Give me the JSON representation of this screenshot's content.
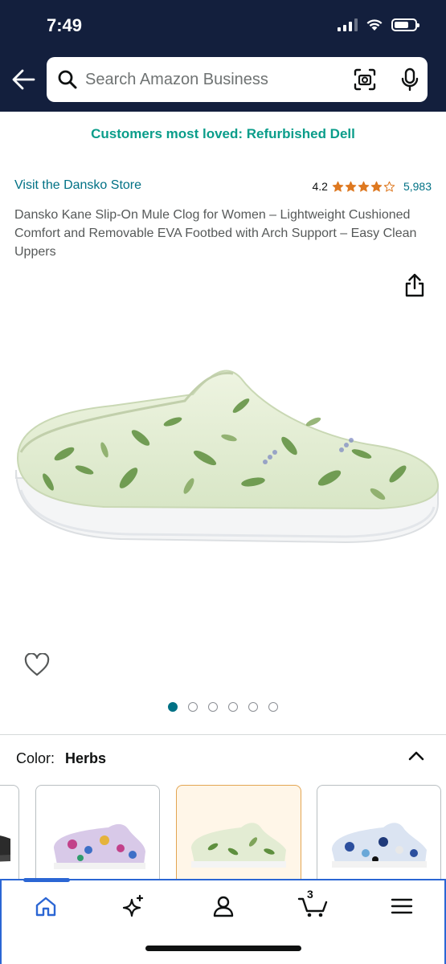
{
  "status_bar": {
    "time": "7:49",
    "battery_level": 0.7
  },
  "search": {
    "placeholder": "Search Amazon Business"
  },
  "icons": {
    "back": "arrow-left-icon",
    "search": "magnifier-icon",
    "camera": "camera-scan-icon",
    "mic": "microphone-icon",
    "share": "share-icon",
    "wishlist": "heart-icon",
    "collapse": "chevron-up-icon",
    "home": "home-icon",
    "ai": "sparkle-icon",
    "account": "person-icon",
    "cart": "cart-icon",
    "menu": "hamburger-icon"
  },
  "promo": {
    "text": "Customers most loved: Refurbished Dell"
  },
  "product": {
    "store_link": "Visit the Dansko Store",
    "rating": "4.2",
    "rating_value": 4.2,
    "review_count": "5,983",
    "title": "Dansko Kane Slip-On Mule Clog for Women – Lightweight Cushioned Comfort and Removable EVA Footbed with Arch Support – Easy Clean Uppers",
    "image_count": 6,
    "active_image_index": 0
  },
  "color": {
    "label": "Color:",
    "value": "Herbs"
  },
  "variants": [
    {
      "name": "Black",
      "selected": false
    },
    {
      "name": "Multi floral",
      "selected": false
    },
    {
      "name": "Herbs",
      "selected": true
    },
    {
      "name": "Blue floral",
      "selected": false
    }
  ],
  "bottom_nav": {
    "cart_count": "3",
    "active": "home"
  },
  "colors": {
    "header_bg": "#131f3d",
    "promo_text": "#0a9d8a",
    "link": "#007185",
    "star": "#de7921",
    "selected_border": "#e3a552",
    "nav_accent": "#2b66d4"
  }
}
